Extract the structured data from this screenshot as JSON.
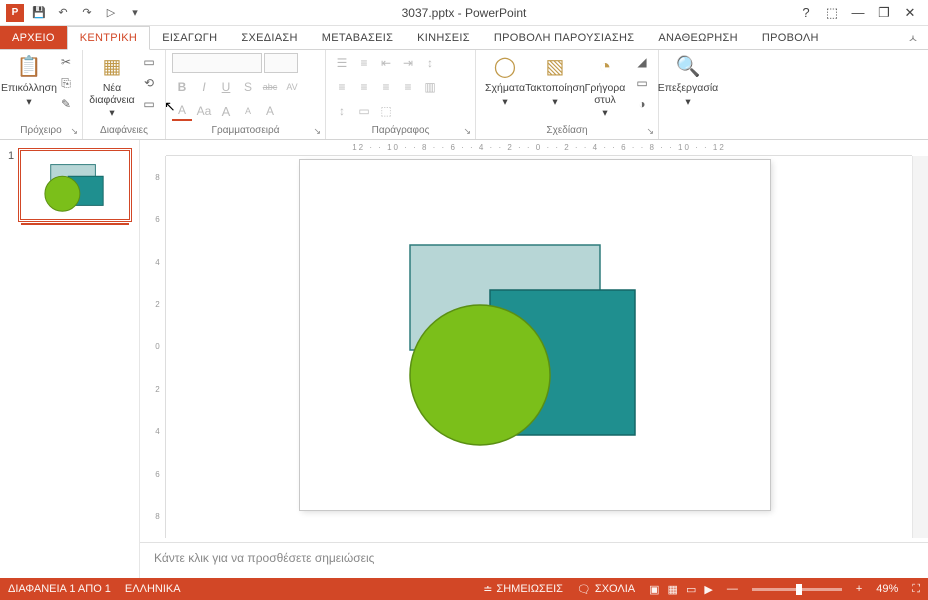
{
  "app": {
    "title": "3037.pptx - PowerPoint",
    "icon_letter": "P"
  },
  "qat": {
    "save": "💾",
    "undo": "↶",
    "redo": "↷",
    "start": "▷",
    "more": "▾"
  },
  "win": {
    "help": "?",
    "opts": "⬚",
    "min": "—",
    "restore": "❐",
    "close": "✕"
  },
  "tabs": {
    "file": "ΑΡΧΕΙΟ",
    "items": [
      "ΚΕΝΤΡΙΚΗ",
      "ΕΙΣΑΓΩΓΗ",
      "ΣΧΕΔΙΑΣΗ",
      "ΜΕΤΑΒΑΣΕΙΣ",
      "ΚΙΝΗΣΕΙΣ",
      "ΠΡΟΒΟΛΗ ΠΑΡΟΥΣΙΑΣΗΣ",
      "ΑΝΑΘΕΩΡΗΣΗ",
      "ΠΡΟΒΟΛΗ"
    ],
    "active_index": 0
  },
  "ribbon": {
    "clipboard": {
      "paste": "Επικόλληση",
      "label": "Πρόχειρο",
      "cut": "✂",
      "copy": "⎘",
      "painter": "✎"
    },
    "slides": {
      "new_slide": "Νέα διαφάνεια",
      "label": "Διαφάνειες",
      "layout": "▭",
      "reset": "⟲",
      "section": "▭"
    },
    "font": {
      "label": "Γραμματοσειρά",
      "b": "B",
      "i": "I",
      "u": "U",
      "s": "S",
      "strike": "abc",
      "av": "AV",
      "aa": "Aa",
      "grow": "A",
      "shrink": "A",
      "color": "A",
      "clear": "A"
    },
    "paragraph": {
      "label": "Παράγραφος"
    },
    "drawing": {
      "shapes": "Σχήματα",
      "arrange": "Τακτοποίηση",
      "styles": "Γρήγορα στυλ",
      "label": "Σχεδίαση"
    },
    "editing": {
      "find": "Επεξεργασία"
    }
  },
  "ruler": "12 · · 10 · · 8 · · 6 · · 4 · · 2 · · 0 · · 2 · · 4 · · 6 · · 8 · · 10 · · 12",
  "ruler_v": [
    "8",
    "6",
    "4",
    "2",
    "0",
    "2",
    "4",
    "6",
    "8"
  ],
  "notes_placeholder": "Κάντε κλικ για να προσθέσετε σημειώσεις",
  "status": {
    "slide": "ΔΙΑΦΑΝΕΙΑ 1 ΑΠΟ 1",
    "lang": "ΕΛΛΗΝΙΚΑ",
    "notes_btn": "ΣΗΜΕΙΩΣΕΙΣ",
    "comments_btn": "ΣΧΟΛΙΑ",
    "zoom": "49%"
  },
  "thumbs": {
    "num": "1"
  },
  "slide_shapes": {
    "rect_light": {
      "fill": "#b7d6d6",
      "stroke": "#2e7b7b"
    },
    "rect_dark": {
      "fill": "#1f8f8f",
      "stroke": "#156666"
    },
    "circle": {
      "fill": "#7bbf1a",
      "stroke": "#5a8f13"
    }
  }
}
